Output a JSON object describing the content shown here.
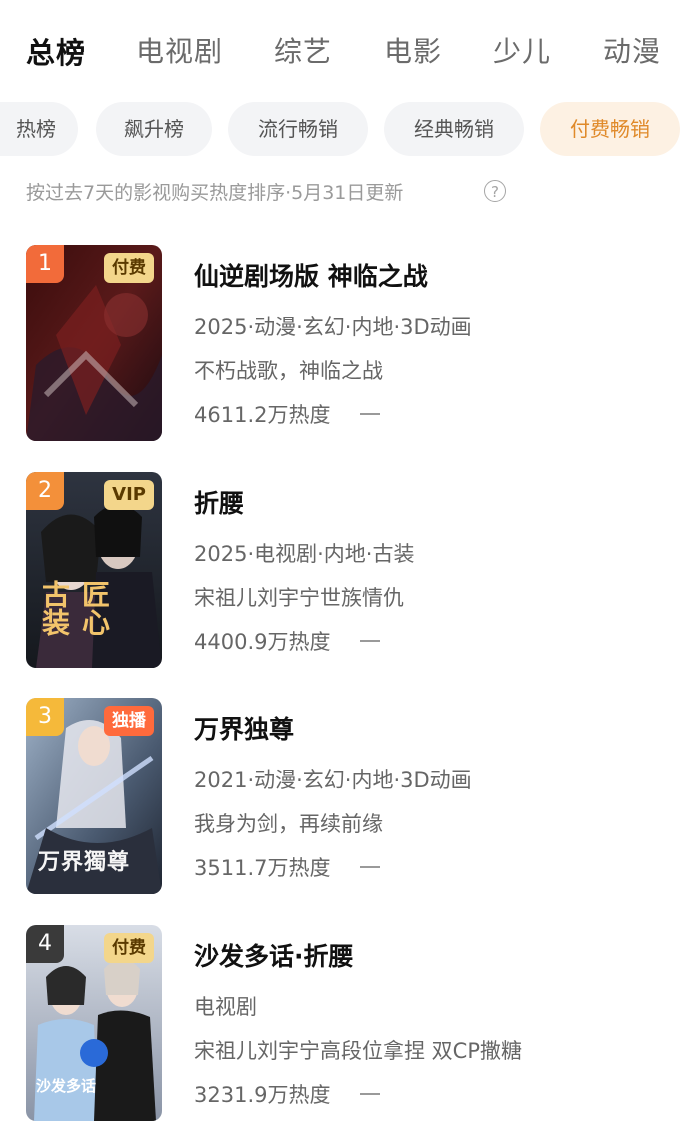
{
  "top_tabs": [
    {
      "label": "总榜",
      "active": true
    },
    {
      "label": "电视剧"
    },
    {
      "label": "综艺"
    },
    {
      "label": "电影"
    },
    {
      "label": "少儿"
    },
    {
      "label": "动漫"
    }
  ],
  "chips": [
    {
      "label": "热榜"
    },
    {
      "label": "飙升榜"
    },
    {
      "label": "流行畅销"
    },
    {
      "label": "经典畅销"
    },
    {
      "label": "付费畅销",
      "active": true
    }
  ],
  "sort_note": "按过去7天的影视购买热度排序·5月31日更新",
  "help_icon": "?",
  "colors": {
    "accent": "#e08a2a",
    "rank1": "#f26b3a",
    "rank2": "#f3903a",
    "rank3": "#f5b93a",
    "rank4": "#3a3a3a"
  },
  "items": [
    {
      "rank": "1",
      "badge": "付费",
      "title": "仙逆剧场版 神临之战",
      "meta": "2025·动漫·玄幻·内地·3D动画",
      "desc": "不朽战歌，神临之战",
      "heat": "4611.2万热度",
      "trend_icon": "flat-dash"
    },
    {
      "rank": "2",
      "badge": "VIP",
      "title": "折腰",
      "meta": "2025·电视剧·内地·古装",
      "desc": "宋祖儿刘宇宁世族情仇",
      "heat": "4400.9万热度",
      "trend_icon": "flat-dash",
      "poster_text": "匠心 古装"
    },
    {
      "rank": "3",
      "badge": "独播",
      "title": "万界独尊",
      "meta": "2021·动漫·玄幻·内地·3D动画",
      "desc": "我身为剑，再续前缘",
      "heat": "3511.7万热度",
      "trend_icon": "flat-dash",
      "poster_text": "万界獨尊"
    },
    {
      "rank": "4",
      "badge": "付费",
      "title": "沙发多话·折腰",
      "meta": "电视剧",
      "desc": "宋祖儿刘宇宁高段位拿捏 双CP撒糖",
      "heat": "3231.9万热度",
      "trend_icon": "flat-dash",
      "poster_text": "沙发多话"
    }
  ]
}
